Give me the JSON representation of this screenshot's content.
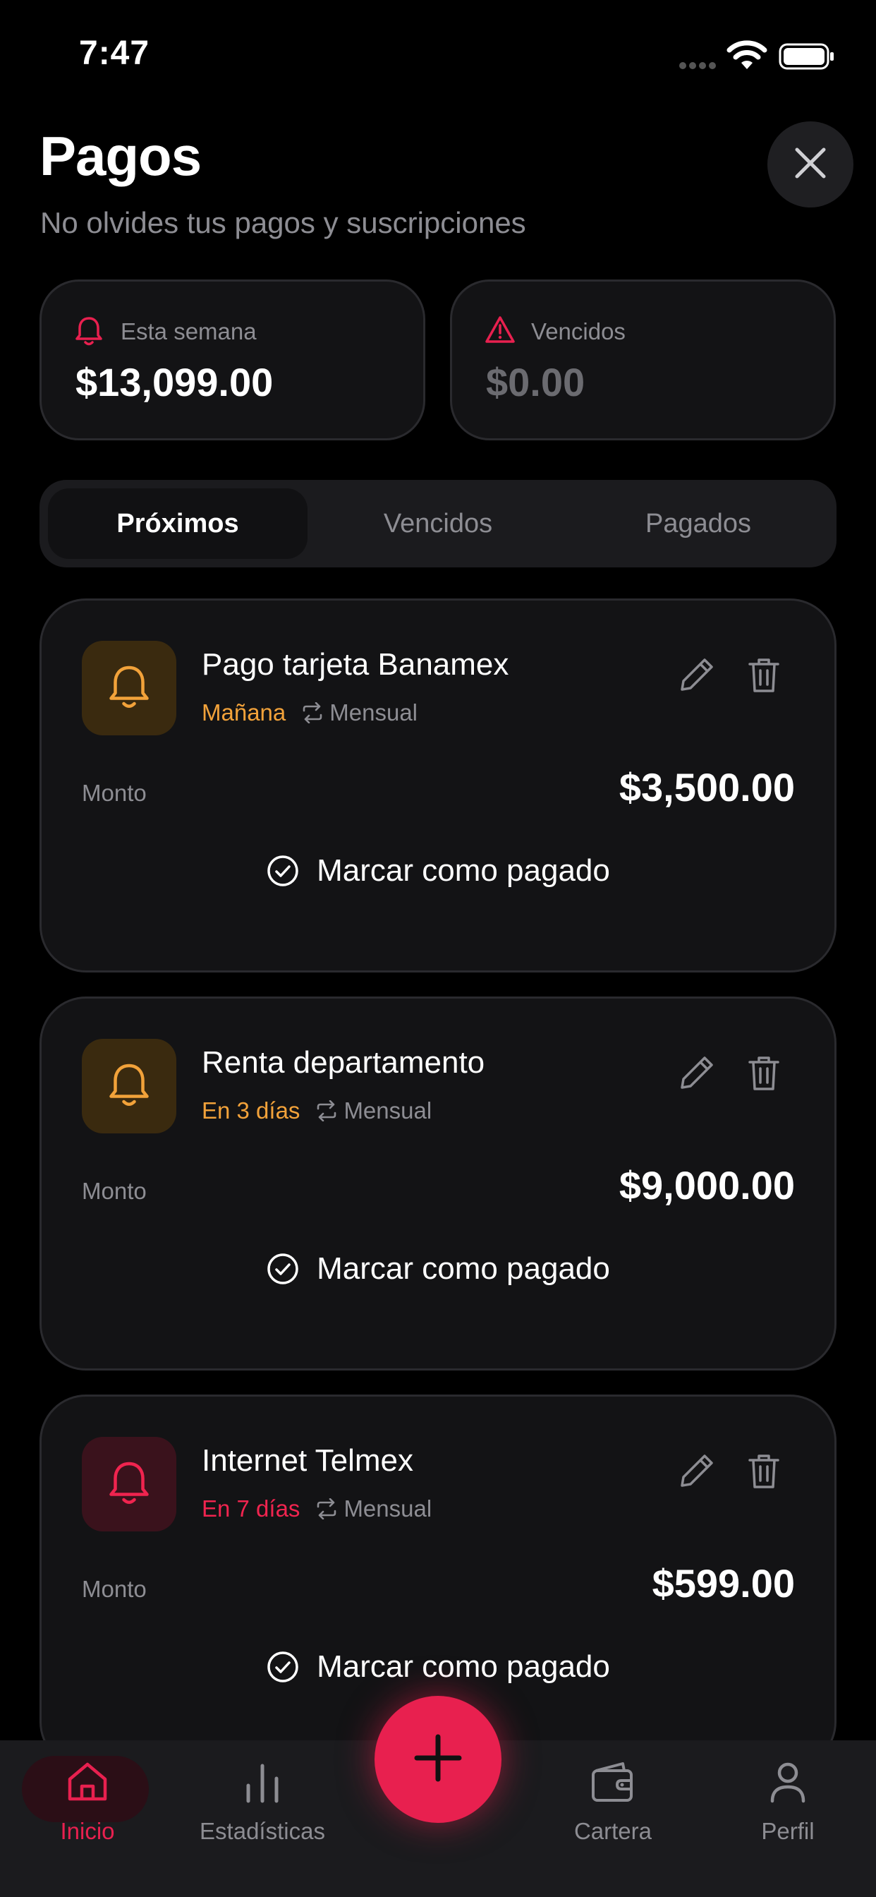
{
  "status_bar": {
    "time": "7:47"
  },
  "header": {
    "title": "Pagos",
    "subtitle": "No olvides tus pagos y suscripciones"
  },
  "summary": [
    {
      "label": "Esta semana",
      "amount": "$13,099.00",
      "icon": "bell-icon",
      "color": "#e8204f"
    },
    {
      "label": "Vencidos",
      "amount": "$0.00",
      "icon": "warning-icon",
      "color": "#e8204f"
    }
  ],
  "tabs": [
    {
      "label": "Próximos",
      "active": true
    },
    {
      "label": "Vencidos",
      "active": false
    },
    {
      "label": "Pagados",
      "active": false
    }
  ],
  "payments": [
    {
      "name": "Pago tarjeta Banamex",
      "due": "Mañana",
      "frequency": "Mensual",
      "amount_label": "Monto",
      "amount": "$3,500.00",
      "action": "Marcar como pagado",
      "accent": "#f2a23a"
    },
    {
      "name": "Renta departamento",
      "due": "En 3 días",
      "frequency": "Mensual",
      "amount_label": "Monto",
      "amount": "$9,000.00",
      "action": "Marcar como pagado",
      "accent": "#f2a23a"
    },
    {
      "name": "Internet Telmex",
      "due": "En 7 días",
      "frequency": "Mensual",
      "amount_label": "Monto",
      "amount": "$599.00",
      "action": "Marcar como pagado",
      "accent": "#f0244f"
    }
  ],
  "nav": [
    {
      "label": "Inicio",
      "icon": "home-icon",
      "active": true
    },
    {
      "label": "Estadísticas",
      "icon": "stats-icon",
      "active": false
    },
    {
      "label": "Cartera",
      "icon": "wallet-icon",
      "active": false
    },
    {
      "label": "Perfil",
      "icon": "user-icon",
      "active": false
    }
  ],
  "colors": {
    "accent": "#e8204f",
    "background": "#000000",
    "card": "#131315",
    "amber": "#f2a23a"
  }
}
